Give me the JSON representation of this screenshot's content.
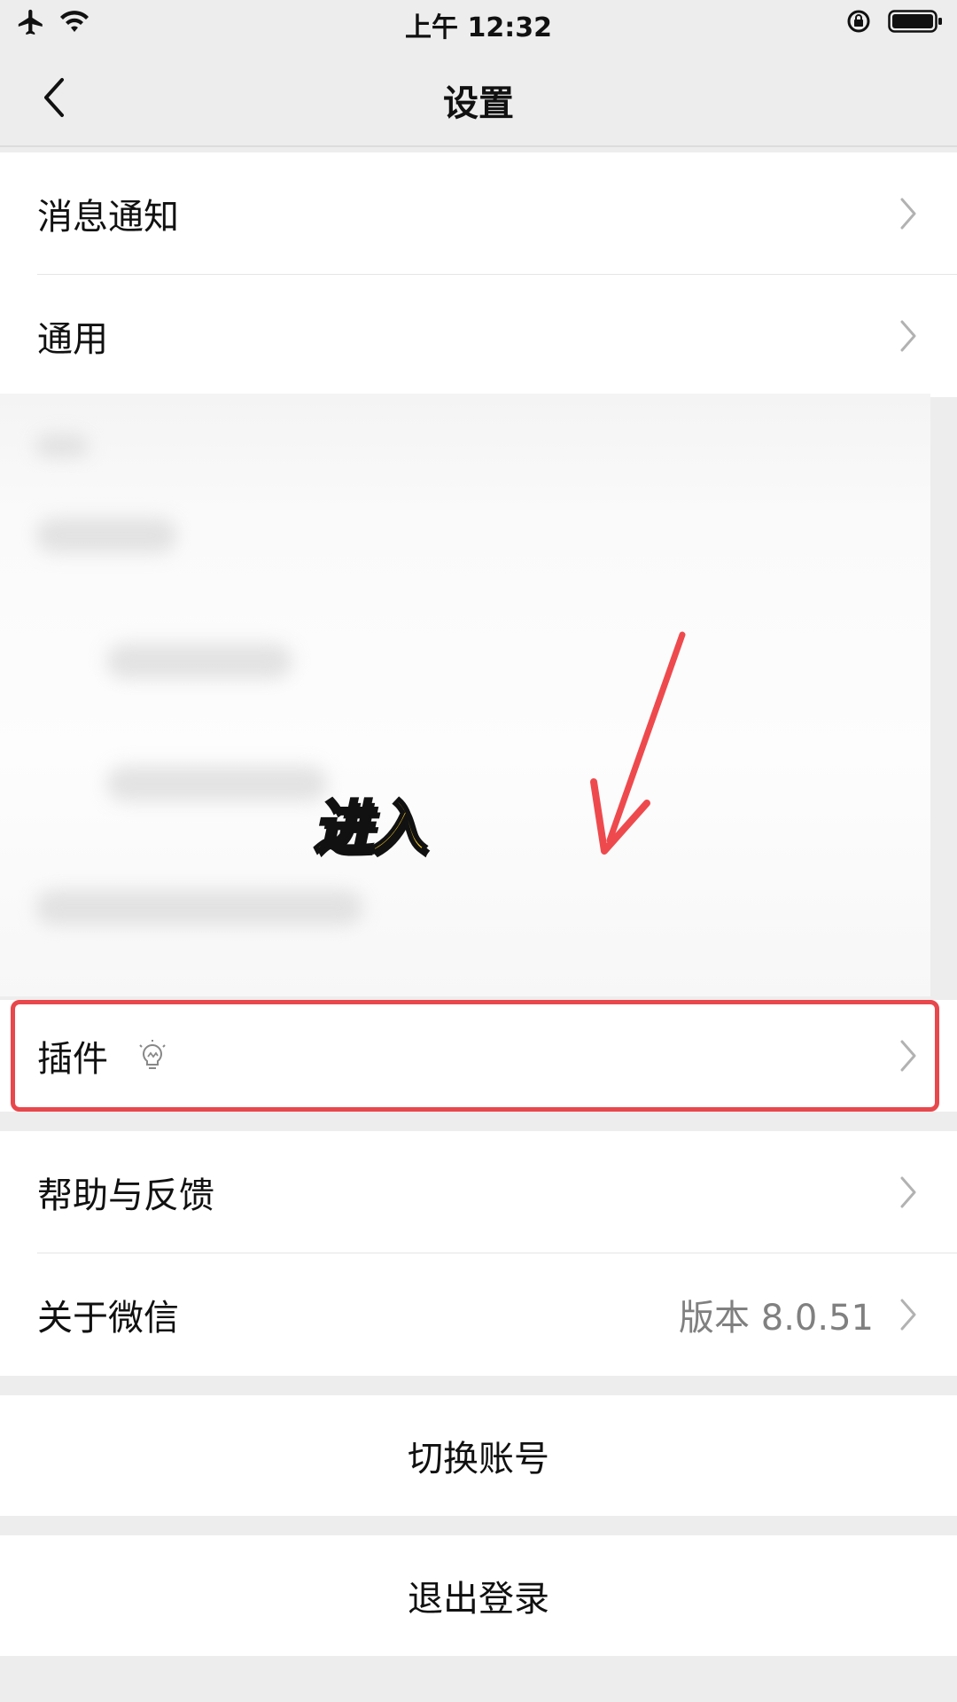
{
  "status_bar": {
    "time": "上午 12:32"
  },
  "nav": {
    "title": "设置"
  },
  "settings": {
    "notifications": "消息通知",
    "general": "通用",
    "plugins": "插件",
    "help_feedback": "帮助与反馈",
    "about": "关于微信",
    "about_version": "版本 8.0.51"
  },
  "actions": {
    "switch_account": "切换账号",
    "logout": "退出登录"
  },
  "annotation": {
    "label": "进入"
  },
  "colors": {
    "highlight": "#e8474c",
    "annotation_text": "#ffd32a"
  }
}
